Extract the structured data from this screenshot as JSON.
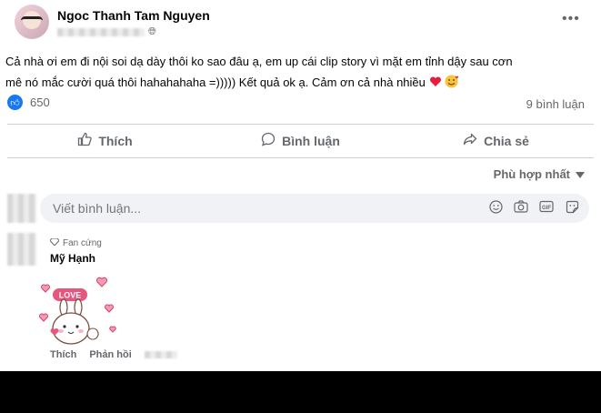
{
  "post": {
    "author": "Ngoc Thanh Tam Nguyen",
    "more_icon": "•••",
    "privacy_icon": "globe-icon",
    "text_line1": "Cả nhà ơi em đi nội soi dạ dày thôi ko sao đâu ạ, em up cái clip story vì mặt em tỉnh dậy sau cơn",
    "text_line2": "mê nó mắc cười quá thôi hahahahaha =))))) Kết quả ok ạ. Cảm ơn cả nhà nhiều",
    "reaction_count": "650",
    "comments_count": "9 bình luận"
  },
  "actions": {
    "like": "Thích",
    "comment": "Bình luận",
    "share": "Chia sẻ"
  },
  "sort_label": "Phù hợp nhất",
  "comment_input": {
    "placeholder": "Viết bình luận..."
  },
  "comment": {
    "badge": "Fan cứng",
    "name": "Mỹ Hạnh",
    "sticker_text": "LOVE",
    "like_label": "Thích",
    "reply_label": "Phản hồi"
  },
  "colors": {
    "accent": "#1877f2",
    "secondary_text": "#65676b",
    "heart": "#e41e3f"
  }
}
